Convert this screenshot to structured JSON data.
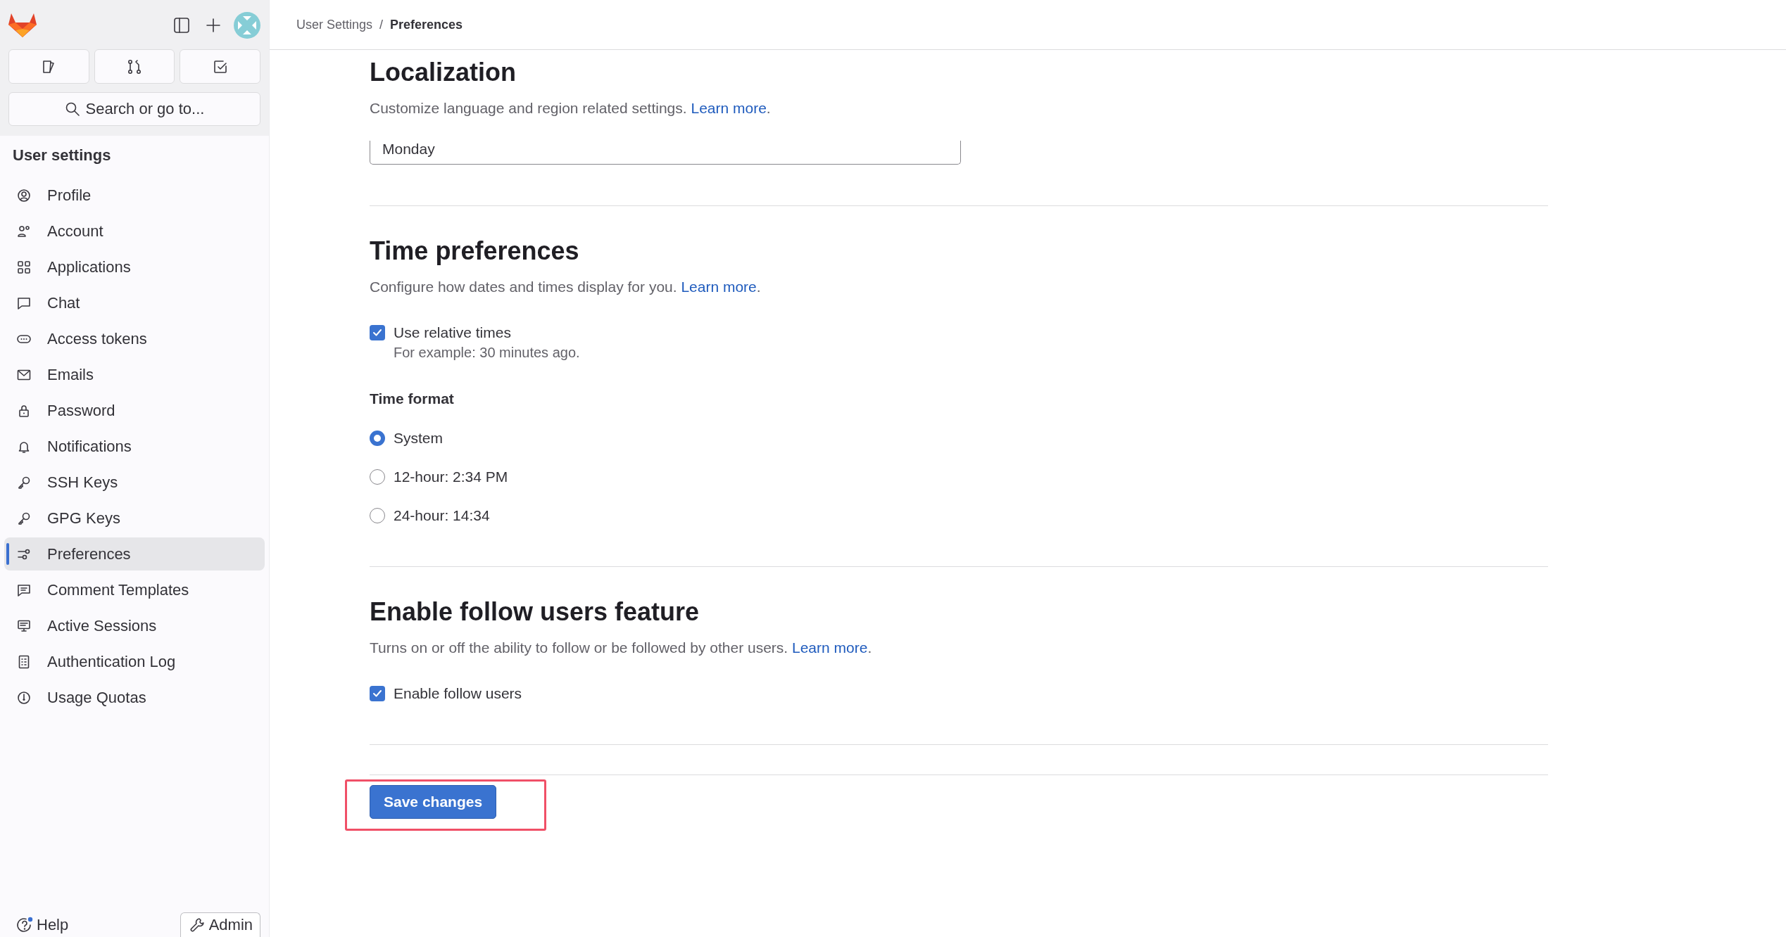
{
  "sidebar": {
    "search": {
      "placeholder": "Search or go to..."
    },
    "heading": "User settings",
    "items": [
      {
        "label": "Profile",
        "selected": false
      },
      {
        "label": "Account",
        "selected": false
      },
      {
        "label": "Applications",
        "selected": false
      },
      {
        "label": "Chat",
        "selected": false
      },
      {
        "label": "Access tokens",
        "selected": false
      },
      {
        "label": "Emails",
        "selected": false
      },
      {
        "label": "Password",
        "selected": false
      },
      {
        "label": "Notifications",
        "selected": false
      },
      {
        "label": "SSH Keys",
        "selected": false
      },
      {
        "label": "GPG Keys",
        "selected": false
      },
      {
        "label": "Preferences",
        "selected": true
      },
      {
        "label": "Comment Templates",
        "selected": false
      },
      {
        "label": "Active Sessions",
        "selected": false
      },
      {
        "label": "Authentication Log",
        "selected": false
      },
      {
        "label": "Usage Quotas",
        "selected": false
      }
    ],
    "help": "Help",
    "admin": "Admin"
  },
  "breadcrumb_separator": "/",
  "breadcrumb": [
    {
      "label": "User Settings",
      "current": false
    },
    {
      "label": "Preferences",
      "current": true
    }
  ],
  "sections": [
    {
      "title": "Localization",
      "description": "Customize language and region related settings.",
      "link": "Learn more",
      "description_end": ".",
      "controls": [
        {
          "kind": "field",
          "value": "Monday"
        }
      ]
    },
    {
      "title": "Time preferences",
      "description": "Configure how dates and times display for you.",
      "link": "Learn more",
      "description_end": ".",
      "controls": [
        {
          "kind": "checkbox",
          "label": "Use relative times",
          "checked": true,
          "hint": "For example: 30 minutes ago."
        },
        {
          "kind": "radio_group",
          "label": "Time format",
          "options": [
            {
              "label": "System",
              "selected": true
            },
            {
              "label": "12-hour: 2:34 PM",
              "selected": false
            },
            {
              "label": "24-hour: 14:34",
              "selected": false
            }
          ]
        }
      ]
    },
    {
      "title": "Enable follow users feature",
      "description": "Turns on or off the ability to follow or be followed by other users.",
      "link": "Learn more",
      "description_end": ".",
      "controls": [
        {
          "kind": "checkbox",
          "label": "Enable follow users",
          "checked": true
        }
      ]
    }
  ],
  "save_button": {
    "label": "Save changes",
    "highlighted": true
  }
}
